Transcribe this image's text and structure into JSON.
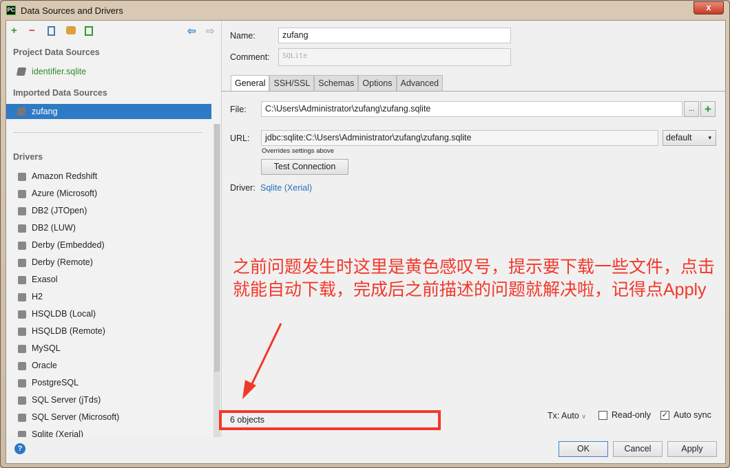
{
  "window": {
    "title": "Data Sources and Drivers",
    "app_icon": "PC",
    "close": "x"
  },
  "toolbar": {
    "add": "+",
    "remove": "−",
    "copy": "copy-icon",
    "settings": "wrench-icon",
    "import": "import-icon",
    "back": "⇦",
    "forward": "⇨"
  },
  "sidebar": {
    "project_header": "Project Data Sources",
    "project_items": [
      {
        "label": "identifier.sqlite",
        "color": "#2e8b2e"
      }
    ],
    "imported_header": "Imported Data Sources",
    "imported_items": [
      {
        "label": "zufang",
        "selected": true
      }
    ],
    "drivers_header": "Drivers",
    "drivers": [
      "Amazon Redshift",
      "Azure (Microsoft)",
      "DB2 (JTOpen)",
      "DB2 (LUW)",
      "Derby (Embedded)",
      "Derby (Remote)",
      "Exasol",
      "H2",
      "HSQLDB (Local)",
      "HSQLDB (Remote)",
      "MySQL",
      "Oracle",
      "PostgreSQL",
      "SQL Server (jTds)",
      "SQL Server (Microsoft)",
      "Sqlite (Xerial)"
    ]
  },
  "form": {
    "name_label": "Name:",
    "name_value": "zufang",
    "comment_label": "Comment:",
    "comment_placeholder": "SQLite",
    "tabs": [
      "General",
      "SSH/SSL",
      "Schemas",
      "Options",
      "Advanced"
    ],
    "active_tab": "General",
    "file_label": "File:",
    "file_value": "C:\\Users\\Administrator\\zufang\\zufang.sqlite",
    "browse": "...",
    "add": "+",
    "url_label": "URL:",
    "url_value": "jdbc:sqlite:C:\\Users\\Administrator\\zufang\\zufang.sqlite",
    "url_mode": "default",
    "url_hint": "Overrides settings above",
    "test_connection": "Test Connection",
    "driver_label": "Driver:",
    "driver_link": "Sqlite (Xerial)"
  },
  "status": {
    "objects": "6 objects",
    "tx": "Tx: Auto",
    "read_only": "Read-only",
    "read_only_checked": false,
    "auto_sync": "Auto sync",
    "auto_sync_checked": true
  },
  "buttons": {
    "ok": "OK",
    "cancel": "Cancel",
    "apply": "Apply",
    "help": "?"
  },
  "annotation": {
    "text": "之前问题发生时这里是黄色感叹号，提示要下载一些文件，点击就能自动下载，完成后之前描述的问题就解决啦，记得点Apply",
    "color": "#f2382a"
  }
}
